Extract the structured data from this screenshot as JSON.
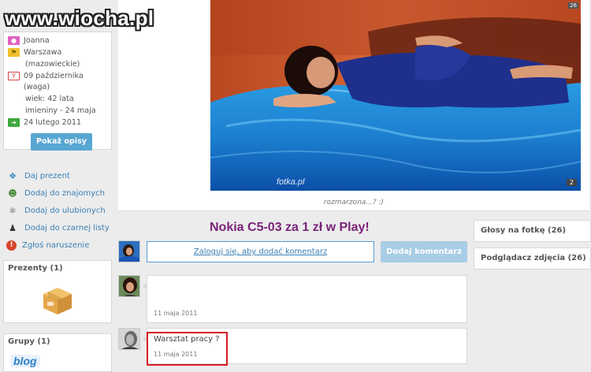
{
  "watermark": "www.wiocha.pl",
  "profile": {
    "rows": [
      {
        "icon": "person-icon",
        "text": "Joanna"
      },
      {
        "icon": "flag-icon",
        "text": "Warszawa"
      },
      {
        "icon": "",
        "text": "(mazowieckie)"
      },
      {
        "icon": "cake-icon",
        "text": "09 października (waga)"
      },
      {
        "icon": "",
        "text": "wiek: 42 lata"
      },
      {
        "icon": "",
        "text": "imieniny - 24 maja"
      },
      {
        "icon": "arrow-icon",
        "text": "24 lutego 2011"
      }
    ],
    "button": "Pokaż opisy"
  },
  "actions": [
    {
      "icon": "gift-icon",
      "label": "Daj prezent"
    },
    {
      "icon": "add-friend-icon",
      "label": "Dodaj do znajomych"
    },
    {
      "icon": "star-icon",
      "label": "Dodaj do ulubionych"
    },
    {
      "icon": "blacklist-icon",
      "label": "Dodaj do czarnej listy"
    },
    {
      "icon": "report-icon",
      "label": "Zgłoś naruszenie"
    }
  ],
  "gifts": {
    "title": "Prezenty (1)"
  },
  "groups": {
    "title": "Grupy (1)",
    "item": "blog"
  },
  "photo": {
    "caption": "rozmarzona...? :)",
    "source": "fotka.pl",
    "count": "2",
    "corner_badge": "26"
  },
  "ad": "Nokia C5-03 za 1 zł w Play!",
  "comment_form": {
    "prompt": "Zaloguj się, aby dodać komentarz",
    "button": "Dodaj komentarz"
  },
  "comments": [
    {
      "text": "",
      "date": "11 maja 2011"
    },
    {
      "text": "Warsztat pracy ?",
      "date": "11 maja 2011"
    }
  ],
  "right": {
    "votes": "Głosy na fotkę (26)",
    "viewers": "Podglądacz zdjęcia (26)"
  },
  "colors": {
    "link": "#3a7fb5",
    "ad": "#7a237a",
    "button": "#58a6d2",
    "highlight": "#d71c24"
  }
}
